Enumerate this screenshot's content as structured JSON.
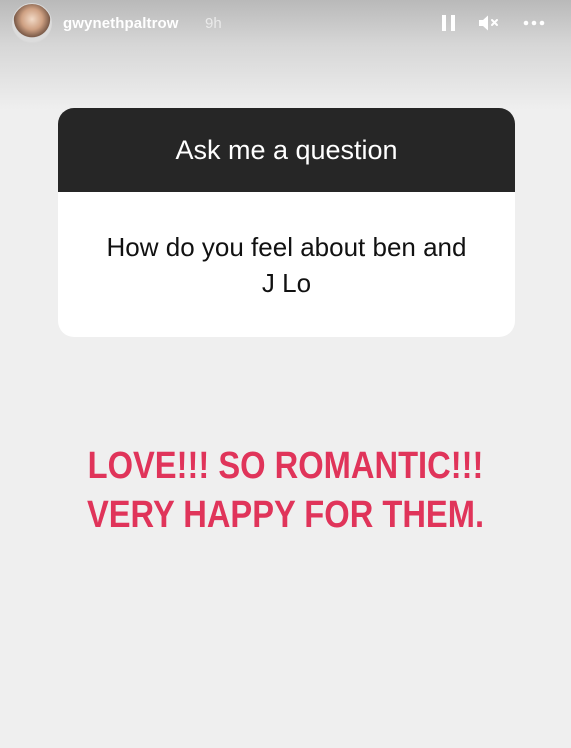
{
  "header": {
    "username": "gwynethpaltrow",
    "time": "9h",
    "icons": [
      "avatar",
      "pause-icon",
      "mute-icon",
      "more-icon"
    ]
  },
  "question_card": {
    "title": "Ask me a question",
    "question": "How do you feel about ben and J Lo"
  },
  "answer": {
    "line1": "LOVE!!! SO ROMANTIC!!!",
    "line2": "VERY HAPPY FOR THEM."
  },
  "colors": {
    "background": "#efefef",
    "card_header": "#262626",
    "answer_text": "#e0345a"
  }
}
